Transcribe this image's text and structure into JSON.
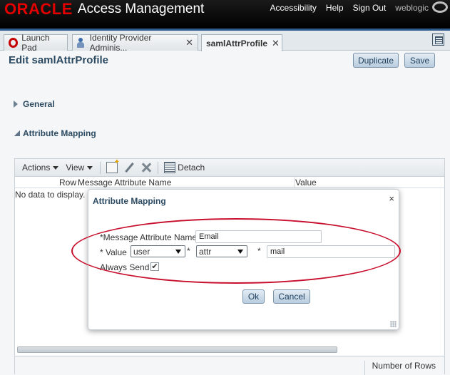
{
  "header": {
    "brand": "ORACLE",
    "product": "Access Management",
    "links": [
      "Accessibility",
      "Help",
      "Sign Out"
    ],
    "user": "weblogic"
  },
  "tabs": [
    {
      "label": "Launch Pad",
      "icon": "launch-pad-icon",
      "closable": false,
      "active": false
    },
    {
      "label": "Identity Provider Adminis...",
      "icon": "user-icon",
      "closable": true,
      "active": false
    },
    {
      "label": "samlAttrProfile",
      "icon": "",
      "closable": true,
      "active": true
    }
  ],
  "page": {
    "title": "Edit samlAttrProfile",
    "duplicate_label": "Duplicate",
    "save_label": "Save"
  },
  "sections": {
    "general": "General",
    "attribute_mapping": "Attribute Mapping"
  },
  "table": {
    "toolbar": {
      "actions": "Actions",
      "view": "View",
      "detach": "Detach"
    },
    "columns": {
      "row": "Row",
      "name": "Message Attribute Name",
      "value": "Value"
    },
    "empty_text": "No data to display.",
    "footer": "Number of Rows"
  },
  "dialog": {
    "title": "Attribute Mapping",
    "close": "×",
    "name_label": "Message Attribute Name",
    "name_value": "Email",
    "value_label": "Value",
    "value_select": "user",
    "attr_select": "attr",
    "attr_text": "mail",
    "always_send_label": "Always Send",
    "always_send_checked": true,
    "ok_label": "Ok",
    "cancel_label": "Cancel",
    "required_marker": "*"
  },
  "colors": {
    "brand_red": "#e20000",
    "header_bg": "#000000",
    "accent_blue": "#2c4a62",
    "annotation": "#c8102e"
  }
}
